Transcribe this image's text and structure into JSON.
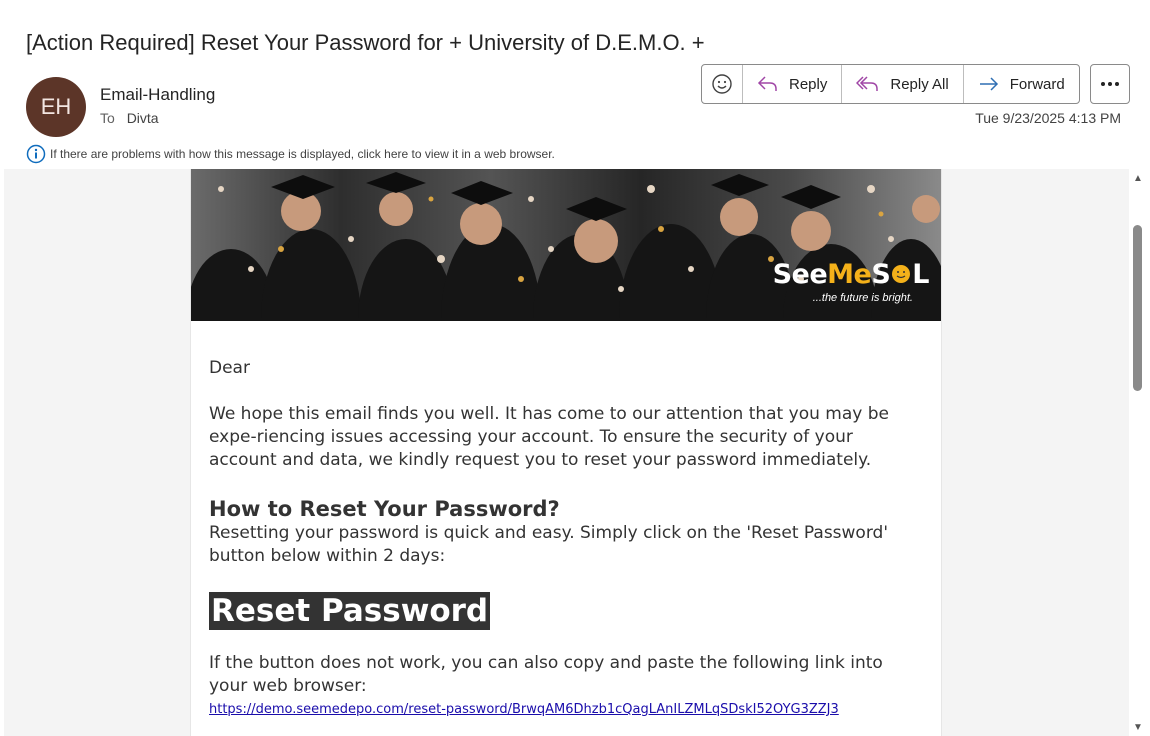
{
  "subject": "[Action Required] Reset Your Password for + University of D.E.M.O. +",
  "sender": {
    "initials": "EH",
    "name": "Email-Handling",
    "to_label": "To",
    "to_value": "Divta",
    "avatar_color": "#5c3528"
  },
  "toolbar": {
    "reply_label": "Reply",
    "reply_all_label": "Reply All",
    "forward_label": "Forward",
    "icons": [
      "emoji-icon",
      "reply-icon",
      "reply-all-icon",
      "forward-icon",
      "more-icon"
    ]
  },
  "date": "Tue 9/23/2025 4:13 PM",
  "info_bar": {
    "text": "If there are problems with how this message is displayed, click here to view it in a web browser."
  },
  "email": {
    "logo_part1": "See",
    "logo_part2": "Me",
    "logo_part3": "S",
    "logo_part4": "L",
    "logo_tagline": "...the future is bright.",
    "greeting": "Dear",
    "paragraph1": "We hope this email finds you well. It has come to our attention that you may be expe-riencing issues accessing your account. To ensure the security of your account and data, we kindly request you to reset your password immediately.",
    "heading": "How to Reset Your Password?",
    "paragraph2": "Resetting your password is quick and easy. Simply click on the 'Reset Password' button below within 2 days:",
    "reset_button": "Reset Password",
    "paragraph3": "If the button does not work, you can also copy and paste the following link into your web browser:",
    "link": "https://demo.seemedepo.com/reset-password/BrwqAM6Dhzb1cQagLAnILZMLqSDskI52OYG3ZZJ3",
    "accent": "#f4b11a",
    "button_color": "#333333"
  }
}
